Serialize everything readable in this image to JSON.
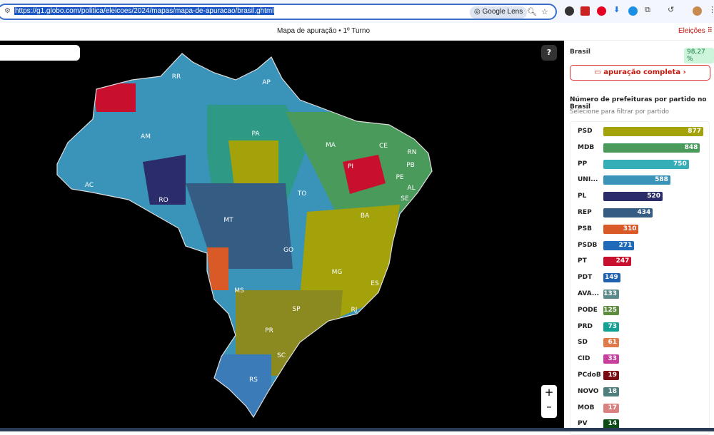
{
  "browser": {
    "url": "https://g1.globo.com/politica/eleicoes/2024/mapas/mapa-de-apuracao/brasil.ghtml",
    "lens_label": "Google Lens"
  },
  "header": {
    "title": "Mapa de apuração • 1º Turno",
    "menu_label": "Eleições"
  },
  "map": {
    "help_label": "?",
    "zoom_in_label": "+",
    "states": [
      "RR",
      "AP",
      "AM",
      "PA",
      "MA",
      "CE",
      "RN",
      "PB",
      "PI",
      "PE",
      "AL",
      "SE",
      "AC",
      "RO",
      "TO",
      "BA",
      "MT",
      "GO",
      "MG",
      "ES",
      "MS",
      "SP",
      "RJ",
      "PR",
      "SC",
      "RS"
    ]
  },
  "sidebar": {
    "region": "Brasil",
    "progress": "98,27 %",
    "progress_value": 98.27,
    "button": "apuração completa",
    "heading": "Número de prefeituras por partido no Brasil",
    "subheading": "Selecione para filtrar por partido"
  },
  "chart_data": {
    "type": "bar",
    "categories": [
      "PSD",
      "MDB",
      "PP",
      "UNI...",
      "PL",
      "REP",
      "PSB",
      "PSDB",
      "PT",
      "PDT",
      "AVA...",
      "PODE",
      "PRD",
      "SD",
      "CID",
      "PCdoB",
      "NOVO",
      "MOB",
      "PV"
    ],
    "values": [
      877,
      848,
      750,
      588,
      520,
      434,
      310,
      271,
      247,
      149,
      133,
      125,
      73,
      61,
      33,
      19,
      18,
      17,
      14
    ],
    "value_labels": [
      "877",
      "848",
      "750",
      "588",
      "520",
      "434",
      "310",
      "271",
      "247",
      "149",
      "133",
      "125",
      "73",
      "61",
      "33",
      "19",
      "18",
      "17",
      "14"
    ],
    "colors": [
      "#a3a20a",
      "#4a9a5c",
      "#35aeb8",
      "#3a93b8",
      "#2b2d6b",
      "#355d84",
      "#d95a26",
      "#1f6bba",
      "#c8102e",
      "#2062ad",
      "#5b8a8a",
      "#5e8c3f",
      "#13a095",
      "#e07a4a",
      "#c93fa0",
      "#7a0a14",
      "#4f7e7e",
      "#d98080",
      "#0d4d14"
    ]
  }
}
